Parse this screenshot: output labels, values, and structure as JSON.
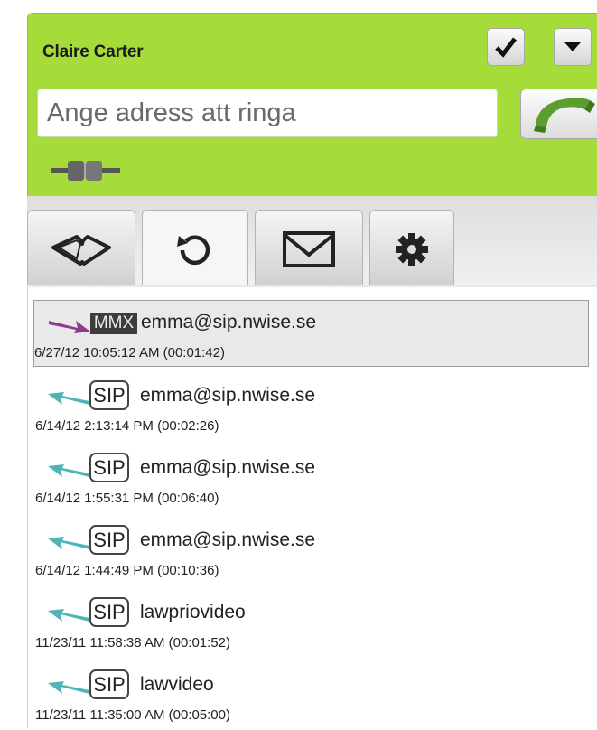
{
  "header": {
    "user_name": "Claire Carter",
    "address_placeholder": "Ange adress att ringa"
  },
  "icons": {
    "confirm": "checkmark-icon",
    "menu": "triangle-down-icon",
    "call": "phone-handset-icon",
    "connection": "plug-icon"
  },
  "tabs": [
    {
      "name": "contacts",
      "icon": "open-book-icon"
    },
    {
      "name": "history",
      "icon": "refresh-icon",
      "active": true
    },
    {
      "name": "messages",
      "icon": "envelope-icon"
    },
    {
      "name": "settings",
      "icon": "gear-icon"
    }
  ],
  "history": [
    {
      "type": "MMX",
      "direction": "outgoing",
      "address": "emma@sip.nwise.se",
      "meta": "6/27/12 10:05:12 AM (00:01:42)",
      "selected": true
    },
    {
      "type": "SIP",
      "direction": "incoming",
      "address": "emma@sip.nwise.se",
      "meta": "6/14/12 2:13:14 PM (00:02:26)"
    },
    {
      "type": "SIP",
      "direction": "incoming",
      "address": "emma@sip.nwise.se",
      "meta": "6/14/12 1:55:31 PM (00:06:40)"
    },
    {
      "type": "SIP",
      "direction": "incoming",
      "address": "emma@sip.nwise.se",
      "meta": "6/14/12 1:44:49 PM (00:10:36)"
    },
    {
      "type": "SIP",
      "direction": "incoming",
      "address": "lawpriovideo",
      "meta": "11/23/11 11:58:38 AM (00:01:52)"
    },
    {
      "type": "SIP",
      "direction": "incoming",
      "address": "lawvideo",
      "meta": "11/23/11 11:35:00 AM (00:05:00)"
    }
  ],
  "colors": {
    "header_bg": "#a6dc3a",
    "incoming_arrow": "#4fb3b8",
    "outgoing_arrow": "#8b3a8f",
    "call_green": "#5c9e2e"
  }
}
